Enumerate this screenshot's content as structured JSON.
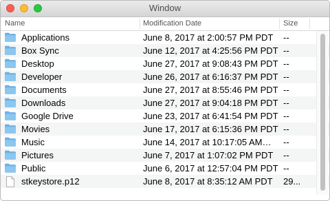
{
  "window": {
    "title": "Window"
  },
  "columns": {
    "name": "Name",
    "date": "Modification Date",
    "size": "Size"
  },
  "files": [
    {
      "icon": "folder-icon",
      "name": "Applications",
      "date": "June 8, 2017 at 2:00:57 PM PDT",
      "size": "--"
    },
    {
      "icon": "folder-icon",
      "name": "Box Sync",
      "date": "June 12, 2017 at 4:25:56 PM PDT",
      "size": "--"
    },
    {
      "icon": "folder-icon",
      "name": "Desktop",
      "date": "June 27, 2017 at 9:08:43 PM PDT",
      "size": "--"
    },
    {
      "icon": "folder-icon",
      "name": "Developer",
      "date": "June 26, 2017 at 6:16:37 PM PDT",
      "size": "--"
    },
    {
      "icon": "folder-icon",
      "name": "Documents",
      "date": "June 27, 2017 at 8:55:46 PM PDT",
      "size": "--"
    },
    {
      "icon": "folder-icon",
      "name": "Downloads",
      "date": "June 27, 2017 at 9:04:18 PM PDT",
      "size": "--"
    },
    {
      "icon": "folder-icon",
      "name": "Google Drive",
      "date": "June 23, 2017 at 6:41:54 PM PDT",
      "size": "--"
    },
    {
      "icon": "folder-icon",
      "name": "Movies",
      "date": "June 17, 2017 at 6:15:36 PM PDT",
      "size": "--"
    },
    {
      "icon": "folder-icon",
      "name": "Music",
      "date": "June 14, 2017 at 10:17:05 AM…",
      "size": "--"
    },
    {
      "icon": "folder-icon",
      "name": "Pictures",
      "date": "June 7, 2017 at 1:07:02 PM PDT",
      "size": "--"
    },
    {
      "icon": "folder-icon",
      "name": "Public",
      "date": "June 6, 2017 at 12:57:04 PM PDT",
      "size": "--"
    },
    {
      "icon": "document-icon",
      "name": "stkeystore.p12",
      "date": "June 8, 2017 at 8:35:12 AM PDT",
      "size": "29..."
    }
  ]
}
